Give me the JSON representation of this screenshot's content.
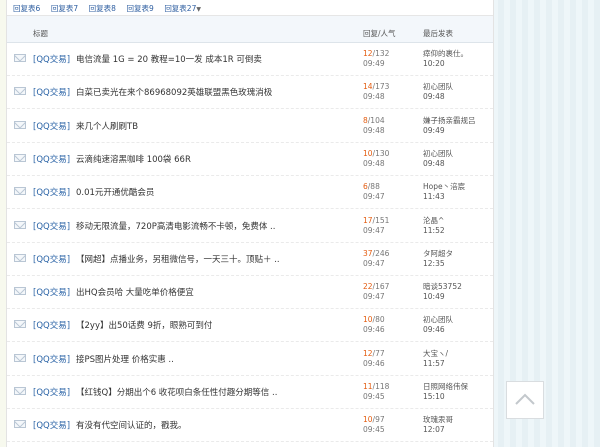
{
  "tabs": [
    "回复表6",
    "回复表7",
    "回复表8",
    "回复表9",
    "回复表27"
  ],
  "header": {
    "title": "标题",
    "replies": "回复/人气",
    "last": "最后发表"
  },
  "rows": [
    {
      "cat": "[QQ交易]",
      "title": "电信流量 1G = 20 教程=10一发 成本1R 可倒卖",
      "replies": "12",
      "views": "/132",
      "date": "09:49",
      "last_user": "瘁仰的裹仕。",
      "last_time": "10:20"
    },
    {
      "cat": "[QQ交易]",
      "title": "白菜已卖光在来个86968092英雄联盟黑色玫瑰消极",
      "replies": "14",
      "views": "/173",
      "date": "09:48",
      "last_user": "初心团队",
      "last_time": "09:48"
    },
    {
      "cat": "[QQ交易]",
      "title": "来几个人刷刷TB",
      "replies": "8",
      "views": "/104",
      "date": "09:48",
      "last_user": "嫌子扬亲霸规吕",
      "last_time": "09:49"
    },
    {
      "cat": "[QQ交易]",
      "title": "云滴纯速溶黑咖啡 100袋 66R",
      "replies": "10",
      "views": "/130",
      "date": "09:48",
      "last_user": "初心团队",
      "last_time": "09:48"
    },
    {
      "cat": "[QQ交易]",
      "title": "0.01元开通优酷会员",
      "replies": "6",
      "views": "/88",
      "date": "09:47",
      "last_user": "Hope丶涪宸",
      "last_time": "11:43"
    },
    {
      "cat": "[QQ交易]",
      "title": "移动无限流量，720P高清电影流畅不卡顿，免费体 ..",
      "replies": "17",
      "views": "/151",
      "date": "09:47",
      "last_user": "沦晶^",
      "last_time": "11:52"
    },
    {
      "cat": "[QQ交易]",
      "title": "【网超】点播业务，另租微信号，一天三十。顶贴＋ ..",
      "replies": "37",
      "views": "/246",
      "date": "09:47",
      "last_user": "タ阿超タ",
      "last_time": "12:35"
    },
    {
      "cat": "[QQ交易]",
      "title": "出HQ会员哈 大量吃单价格便宜",
      "replies": "22",
      "views": "/167",
      "date": "09:47",
      "last_user": "暗谈53752",
      "last_time": "10:49"
    },
    {
      "cat": "[QQ交易]",
      "title": "【2yy】出50话费 9折，眼熟可到付",
      "replies": "10",
      "views": "/80",
      "date": "09:46",
      "last_user": "初心团队",
      "last_time": "09:46"
    },
    {
      "cat": "[QQ交易]",
      "title": "接PS图片处理  价格实惠   ..",
      "replies": "12",
      "views": "/77",
      "date": "09:46",
      "last_user": "大宝ヽ/",
      "last_time": "11:57"
    },
    {
      "cat": "[QQ交易]",
      "title": "【红钱Q】分期出个6 收花呗白条任性付趣分期等信 ..",
      "replies": "11",
      "views": "/118",
      "date": "09:45",
      "last_user": "日照网络伟保",
      "last_time": "15:10"
    },
    {
      "cat": "[QQ交易]",
      "title": "有没有代空间认证的，戳我。",
      "replies": "10",
      "views": "/97",
      "date": "09:45",
      "last_user": "玫瑰汞哥",
      "last_time": "12:07"
    }
  ]
}
